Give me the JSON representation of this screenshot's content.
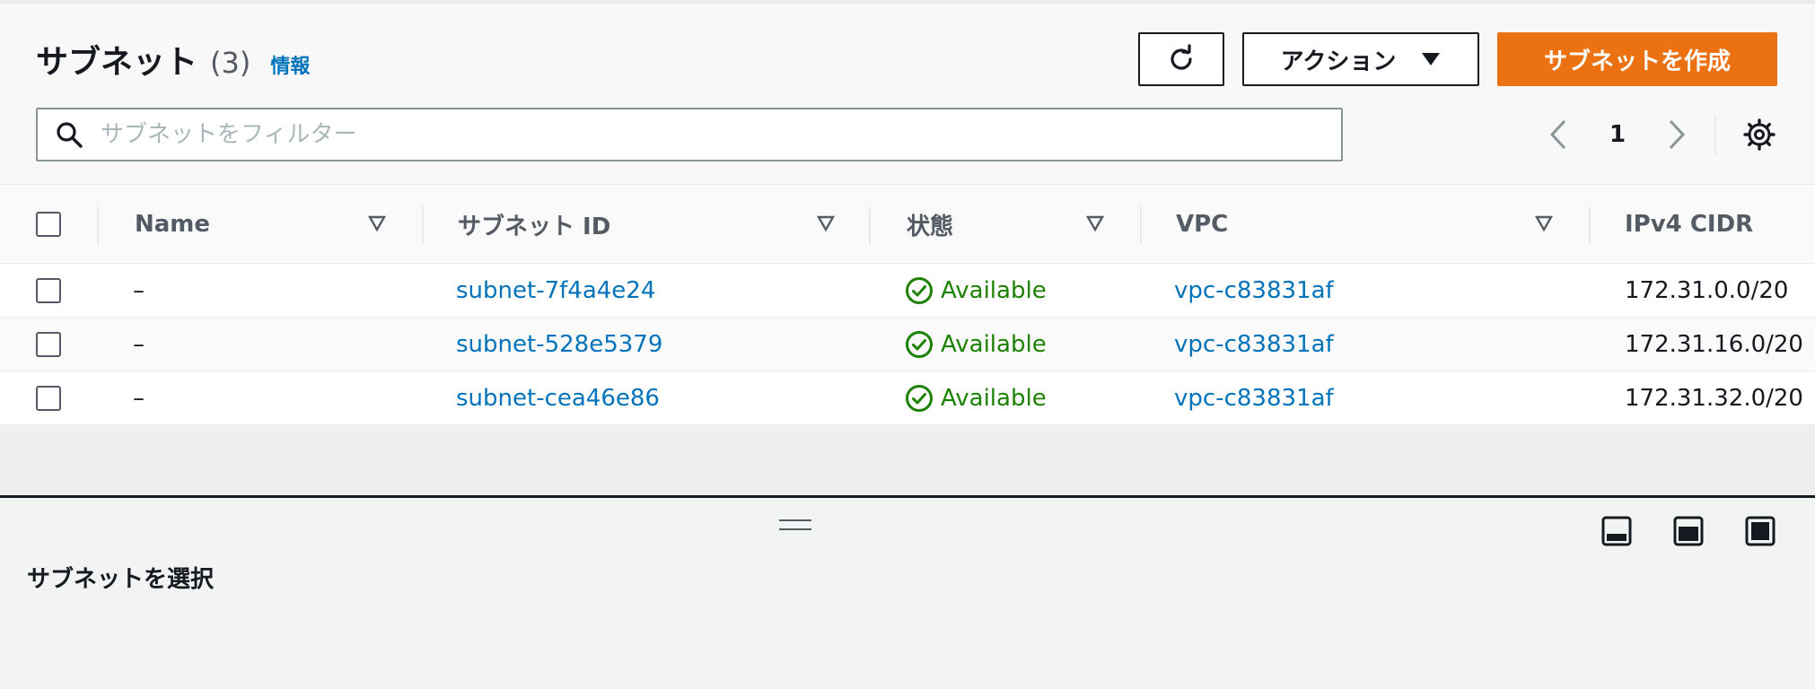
{
  "header": {
    "title": "サブネット",
    "count": "(3)",
    "info_link": "情報",
    "refresh_icon": "refresh-icon",
    "actions_label": "アクション",
    "create_label": "サブネットを作成"
  },
  "search": {
    "placeholder": "サブネットをフィルター",
    "value": ""
  },
  "pagination": {
    "current_page": "1"
  },
  "table": {
    "columns": [
      "Name",
      "サブネット ID",
      "状態",
      "VPC",
      "IPv4 CIDR"
    ],
    "rows": [
      {
        "name": "–",
        "subnet_id": "subnet-7f4a4e24",
        "status": "Available",
        "vpc": "vpc-c83831af",
        "cidr": "172.31.0.0/20"
      },
      {
        "name": "–",
        "subnet_id": "subnet-528e5379",
        "status": "Available",
        "vpc": "vpc-c83831af",
        "cidr": "172.31.16.0/20"
      },
      {
        "name": "–",
        "subnet_id": "subnet-cea46e86",
        "status": "Available",
        "vpc": "vpc-c83831af",
        "cidr": "172.31.32.0/20"
      }
    ]
  },
  "split_panel": {
    "title": "サブネットを選択"
  },
  "colors": {
    "primary": "#ec7211",
    "link": "#0073bb",
    "success": "#1d8102",
    "text": "#16191f",
    "muted": "#545b64"
  }
}
